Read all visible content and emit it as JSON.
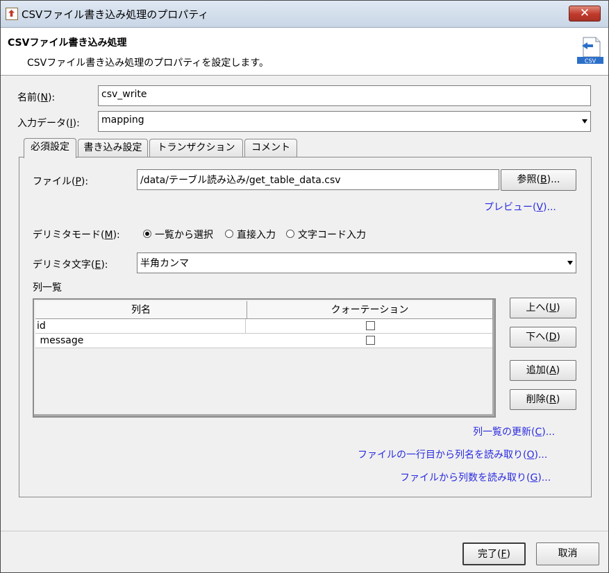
{
  "window": {
    "title": "CSVファイル書き込み処理のプロパティ",
    "close_label": "✕"
  },
  "header": {
    "title": "CSVファイル書き込み処理",
    "description": "CSVファイル書き込み処理のプロパティを設定します。",
    "icon_label": "CSV"
  },
  "name_field": {
    "label": "名前(",
    "mnemonic": "N",
    "label_end": "):",
    "value": "csv_write"
  },
  "input_data": {
    "label": "入力データ(",
    "mnemonic": "I",
    "label_end": "):",
    "value": "mapping"
  },
  "tabs": [
    {
      "label": "必須設定",
      "active": true
    },
    {
      "label": "書き込み設定",
      "active": false
    },
    {
      "label": "トランザクション",
      "active": false
    },
    {
      "label": "コメント",
      "active": false
    }
  ],
  "file": {
    "label": "ファイル(",
    "mnemonic": "P",
    "label_end": "):",
    "value": "/data/テーブル読み込み/get_table_data.csv",
    "browse_label": "参照(",
    "browse_mnemonic": "B",
    "browse_end": ")...",
    "preview_label": "プレビュー(",
    "preview_mnemonic": "V",
    "preview_end": ")..."
  },
  "delimiter_mode": {
    "label": "デリミタモード(",
    "mnemonic": "M",
    "label_end": "):",
    "options": [
      {
        "label": "一覧から選択",
        "selected": true
      },
      {
        "label": "直接入力",
        "selected": false
      },
      {
        "label": "文字コード入力",
        "selected": false
      }
    ]
  },
  "delimiter_char": {
    "label": "デリミタ文字(",
    "mnemonic": "E",
    "label_end": "):",
    "value": "半角カンマ"
  },
  "column_list": {
    "label": "列一覧",
    "headers": [
      "列名",
      "クォーテーション"
    ],
    "rows": [
      {
        "name": "id",
        "quote": false
      },
      {
        "name": " message",
        "quote": false
      }
    ],
    "buttons": {
      "up": {
        "label": "上へ(",
        "mnemonic": "U",
        "end": ")"
      },
      "down": {
        "label": "下へ(",
        "mnemonic": "D",
        "end": ")"
      },
      "add": {
        "label": "追加(",
        "mnemonic": "A",
        "end": ")"
      },
      "delete": {
        "label": "削除(",
        "mnemonic": "R",
        "end": ")"
      }
    }
  },
  "links": {
    "refresh": {
      "label": "列一覧の更新(",
      "mnemonic": "C",
      "end": ")..."
    },
    "read_names": {
      "label": "ファイルの一行目から列名を読み取り(",
      "mnemonic": "O",
      "end": ")..."
    },
    "read_count": {
      "label": "ファイルから列数を読み取り(",
      "mnemonic": "G",
      "end": ")..."
    }
  },
  "footer": {
    "finish": {
      "label": "完了(",
      "mnemonic": "F",
      "end": ")"
    },
    "cancel": "取消"
  },
  "colors": {
    "link": "#2a2ae0",
    "close_button": "#c0392b",
    "titlebar": "#c9d6e6"
  }
}
